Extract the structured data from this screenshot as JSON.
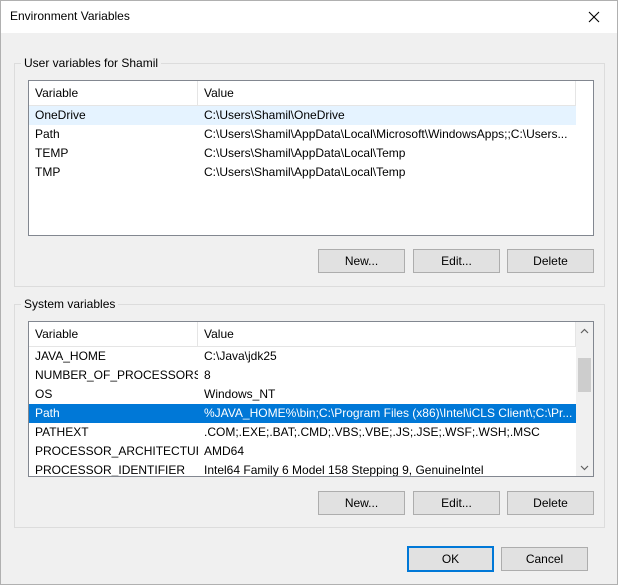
{
  "window": {
    "title": "Environment Variables"
  },
  "user_group": {
    "label": "User variables for Shamil",
    "columns": [
      "Variable",
      "Value"
    ],
    "rows": [
      {
        "variable": "OneDrive",
        "value": "C:\\Users\\Shamil\\OneDrive",
        "state": "hover"
      },
      {
        "variable": "Path",
        "value": "C:\\Users\\Shamil\\AppData\\Local\\Microsoft\\WindowsApps;;C:\\Users...",
        "state": "normal"
      },
      {
        "variable": "TEMP",
        "value": "C:\\Users\\Shamil\\AppData\\Local\\Temp",
        "state": "normal"
      },
      {
        "variable": "TMP",
        "value": "C:\\Users\\Shamil\\AppData\\Local\\Temp",
        "state": "normal"
      }
    ],
    "buttons": {
      "new": "New...",
      "edit": "Edit...",
      "delete": "Delete"
    }
  },
  "system_group": {
    "label": "System variables",
    "columns": [
      "Variable",
      "Value"
    ],
    "rows": [
      {
        "variable": "JAVA_HOME",
        "value": "C:\\Java\\jdk25",
        "state": "normal"
      },
      {
        "variable": "NUMBER_OF_PROCESSORS",
        "value": "8",
        "state": "normal"
      },
      {
        "variable": "OS",
        "value": "Windows_NT",
        "state": "normal"
      },
      {
        "variable": "Path",
        "value": "%JAVA_HOME%\\bin;C:\\Program Files (x86)\\Intel\\iCLS Client\\;C:\\Pr...",
        "state": "selected"
      },
      {
        "variable": "PATHEXT",
        "value": ".COM;.EXE;.BAT;.CMD;.VBS;.VBE;.JS;.JSE;.WSF;.WSH;.MSC",
        "state": "normal"
      },
      {
        "variable": "PROCESSOR_ARCHITECTURE",
        "value": "AMD64",
        "state": "normal"
      },
      {
        "variable": "PROCESSOR_IDENTIFIER",
        "value": "Intel64 Family 6 Model 158 Stepping 9, GenuineIntel",
        "state": "normal"
      }
    ],
    "buttons": {
      "new": "New...",
      "edit": "Edit...",
      "delete": "Delete"
    }
  },
  "footer": {
    "ok": "OK",
    "cancel": "Cancel"
  },
  "colors": {
    "selected": "#0078d7",
    "hover": "#e5f3ff",
    "background": "#f0f0f0"
  },
  "icons": [
    "close-icon",
    "scroll-up-arrow-icon",
    "scroll-down-arrow-icon"
  ]
}
